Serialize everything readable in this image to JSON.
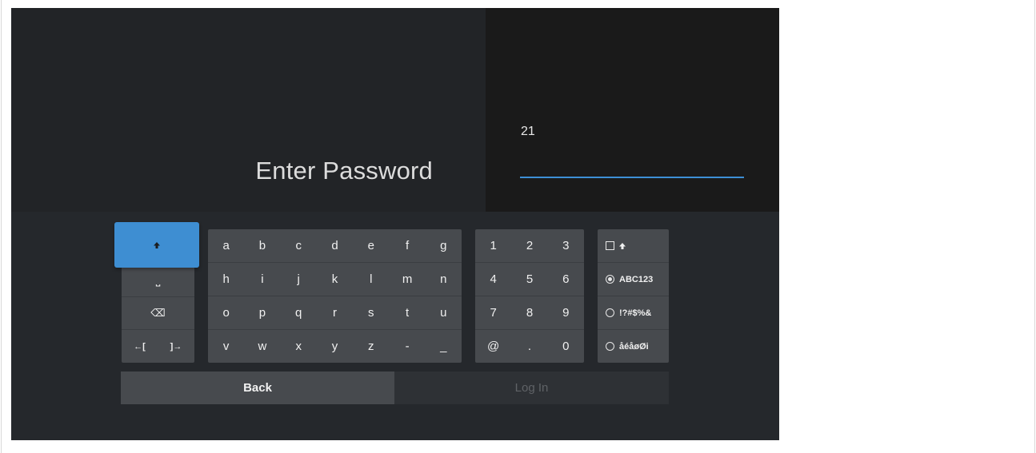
{
  "header": {
    "title": "Enter Password",
    "password_value": "21"
  },
  "controls": {
    "space_icon": "⎵",
    "backspace_icon": "⌫",
    "cursor_left_icon": "←[",
    "cursor_right_icon": "]→"
  },
  "letters": [
    "a",
    "b",
    "c",
    "d",
    "e",
    "f",
    "g",
    "h",
    "i",
    "j",
    "k",
    "l",
    "m",
    "n",
    "o",
    "p",
    "q",
    "r",
    "s",
    "t",
    "u",
    "v",
    "w",
    "x",
    "y",
    "z",
    "-",
    "_"
  ],
  "digits": [
    "1",
    "2",
    "3",
    "4",
    "5",
    "6",
    "7",
    "8",
    "9",
    "@",
    ".",
    "0"
  ],
  "modes": [
    {
      "label": "ABC123",
      "selected": true
    },
    {
      "label": "!?#$%&",
      "selected": false
    },
    {
      "label": "åéåøØi",
      "selected": false
    }
  ],
  "actions": {
    "back_label": "Back",
    "login_label": "Log In"
  },
  "colors": {
    "accent": "#3e8ed2",
    "background": "#25282c",
    "key_panel": "#474a4e"
  }
}
